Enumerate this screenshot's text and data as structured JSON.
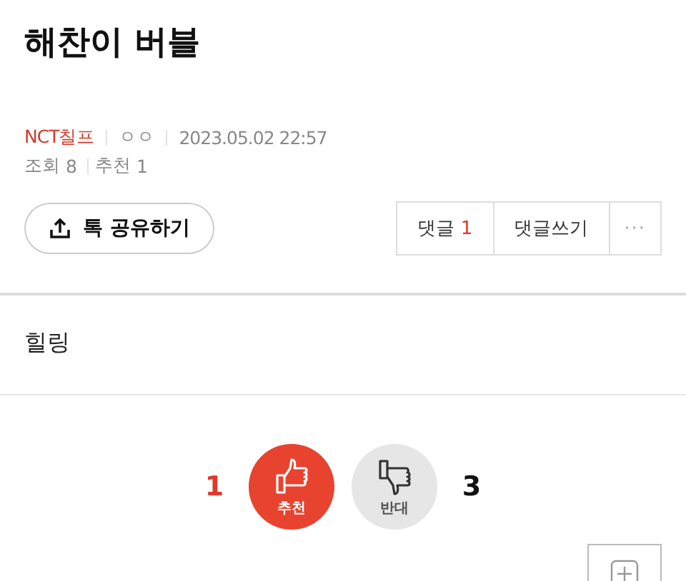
{
  "title": "해찬이 버블",
  "meta": {
    "board": "NCT칠프",
    "author": "ㅇㅇ",
    "datetime": "2023.05.02 22:57",
    "stats": [
      {
        "label": "조회",
        "value": "8"
      },
      {
        "label": "추천",
        "value": "1"
      }
    ]
  },
  "share_button": {
    "label": "톡 공유하기"
  },
  "comment_buttons": {
    "comments": {
      "label": "댓글",
      "count": "1"
    },
    "write": {
      "label": "댓글쓰기"
    },
    "more": {
      "label": "···"
    }
  },
  "body": "힐링",
  "votes": [
    {
      "kind": "up",
      "count": "1",
      "label": "추천"
    },
    {
      "kind": "down",
      "count": "3",
      "label": "반대"
    }
  ]
}
